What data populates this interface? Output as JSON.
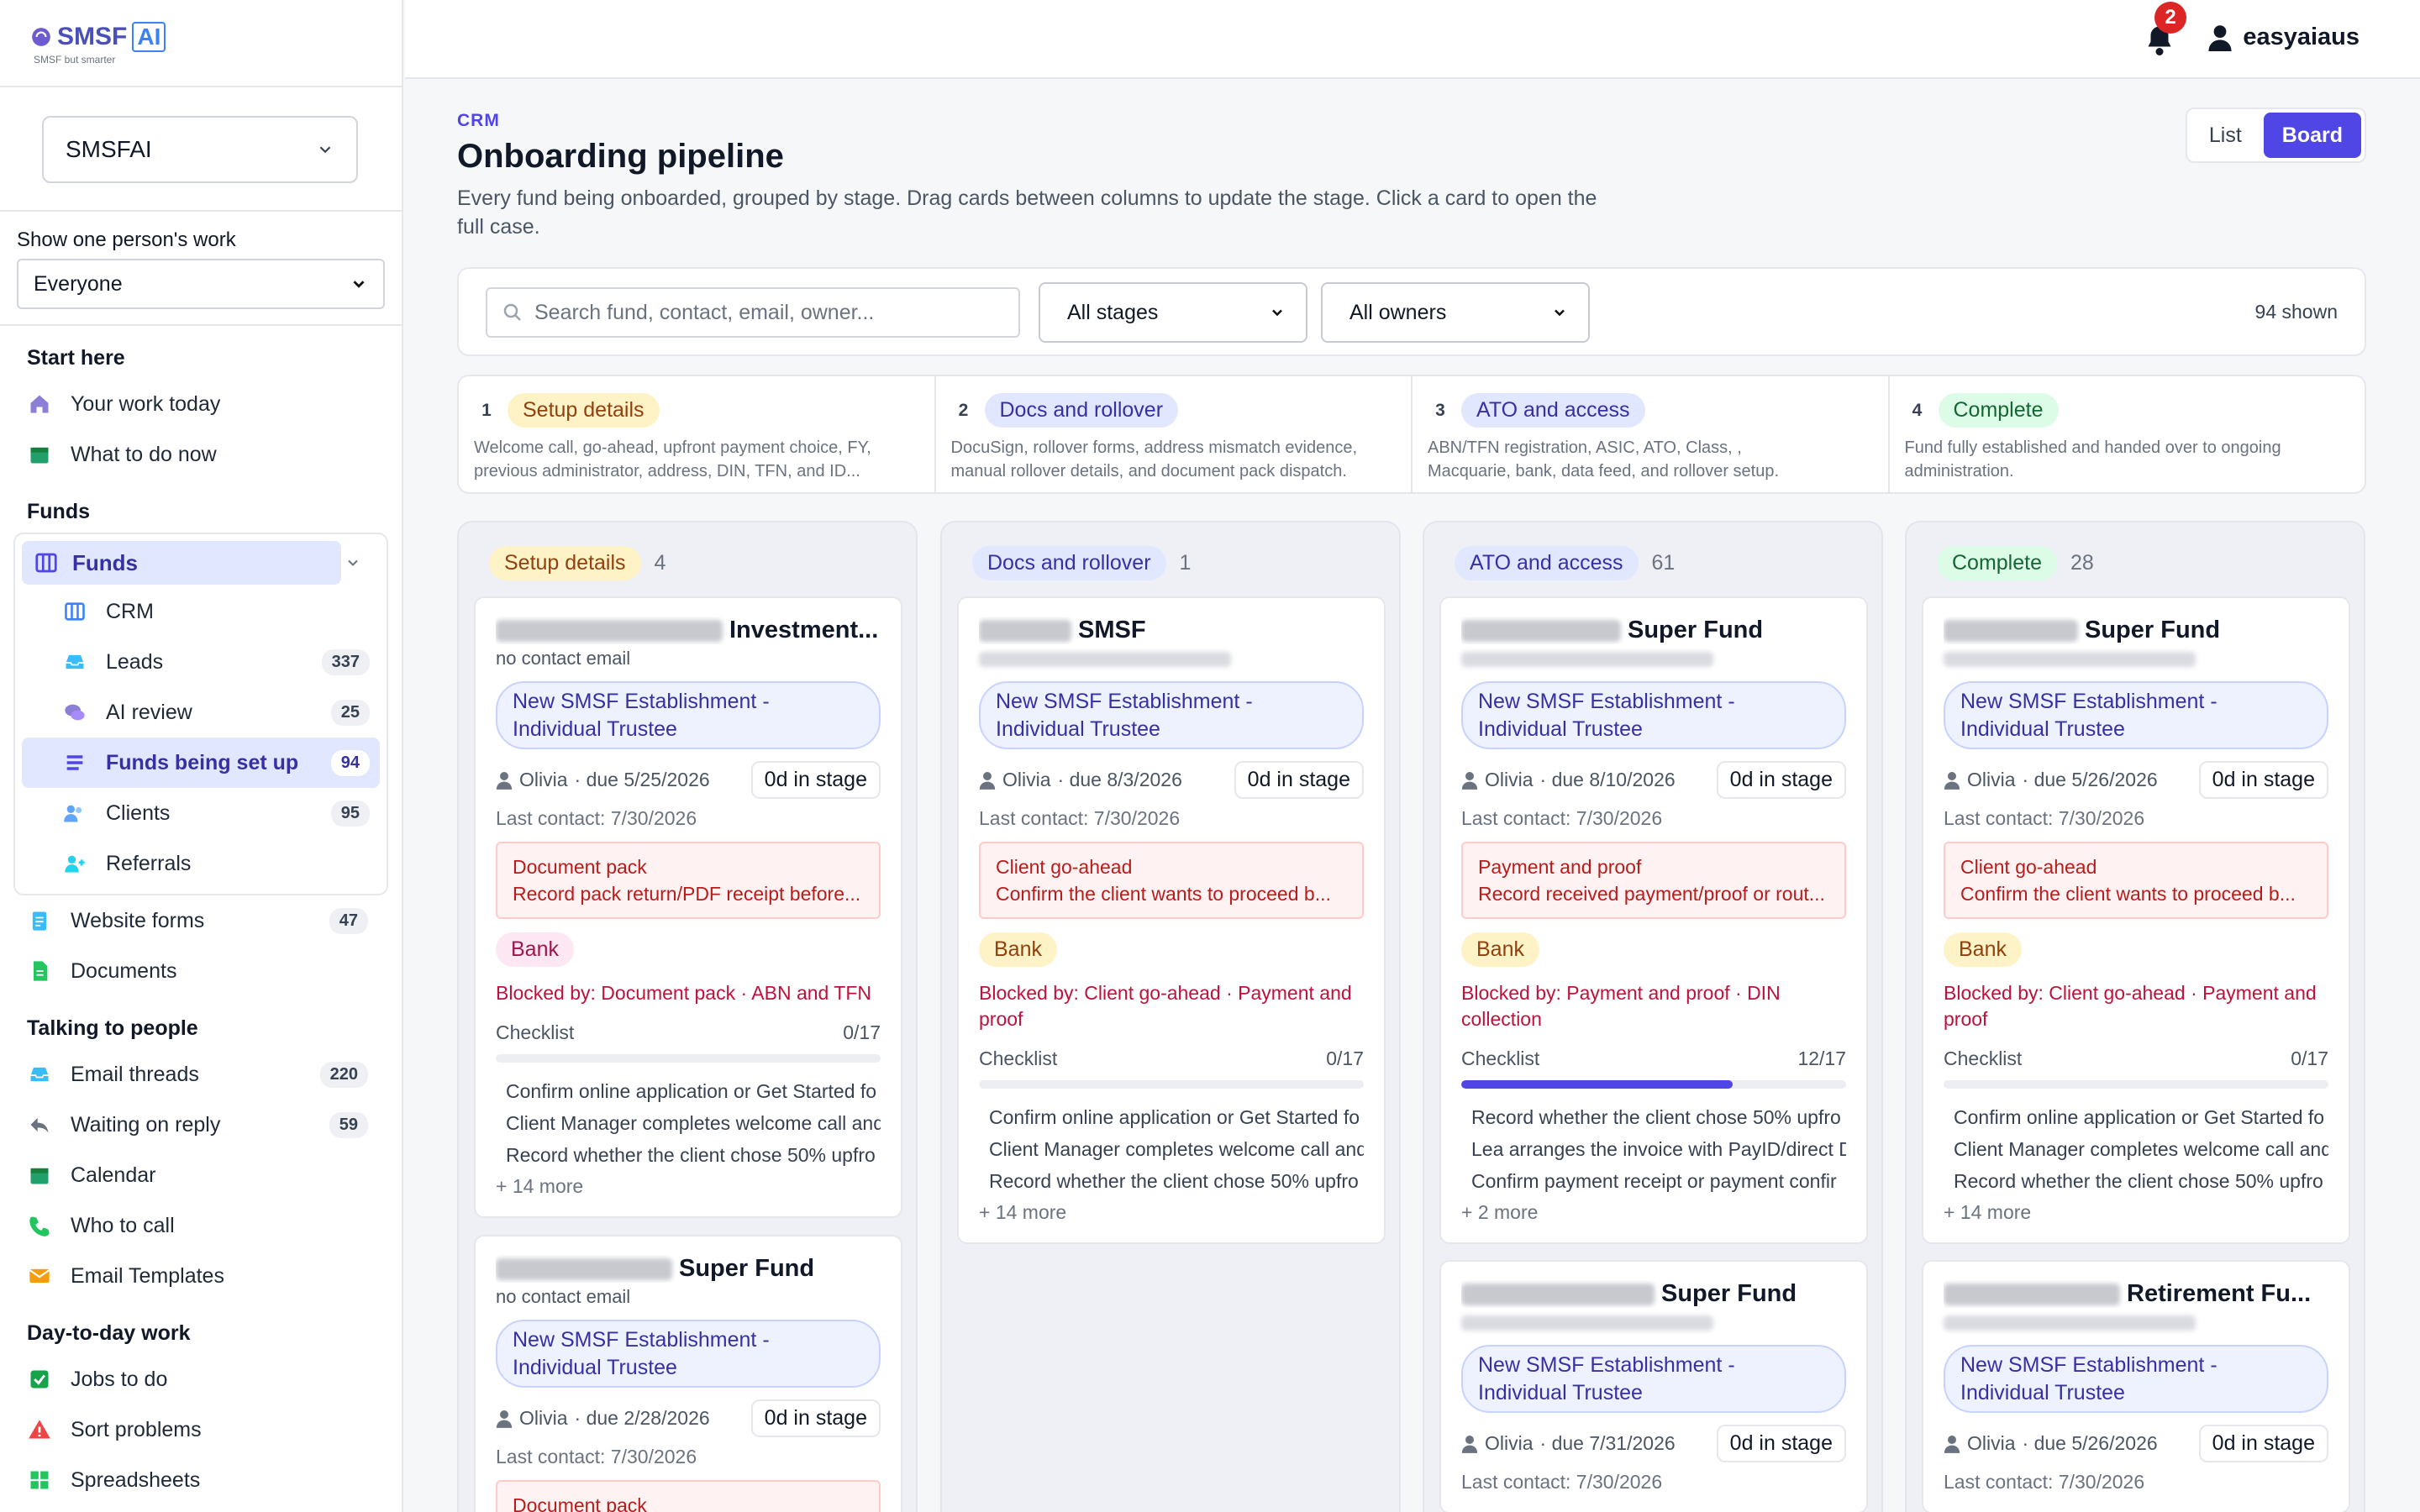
{
  "brand": {
    "name": "SMSF",
    "ai": "AI",
    "tagline": "SMSF but smarter"
  },
  "workspace": {
    "selected": "SMSFAI"
  },
  "person_filter": {
    "label": "Show one person's work",
    "selected": "Everyone"
  },
  "nav": {
    "start_title": "Start here",
    "start": [
      {
        "label": "Your work today",
        "icon": "home-icon"
      },
      {
        "label": "What to do now",
        "icon": "calendar-icon"
      }
    ],
    "funds_title": "Funds",
    "funds_label": "Funds",
    "funds_sub": [
      {
        "label": "CRM",
        "icon": "columns-icon",
        "badge": ""
      },
      {
        "label": "Leads",
        "icon": "inbox-icon",
        "badge": "337"
      },
      {
        "label": "AI review",
        "icon": "chat-icon",
        "badge": "25"
      },
      {
        "label": "Funds being set up",
        "icon": "list-icon",
        "badge": "94"
      },
      {
        "label": "Clients",
        "icon": "users-icon",
        "badge": "95"
      },
      {
        "label": "Referrals",
        "icon": "user-plus-icon",
        "badge": ""
      }
    ],
    "funds_extra": [
      {
        "label": "Website forms",
        "icon": "clipboard-icon",
        "badge": "47"
      },
      {
        "label": "Documents",
        "icon": "document-icon",
        "badge": ""
      }
    ],
    "talk_title": "Talking to people",
    "talk": [
      {
        "label": "Email threads",
        "icon": "inbox-icon",
        "badge": "220"
      },
      {
        "label": "Waiting on reply",
        "icon": "reply-icon",
        "badge": "59"
      },
      {
        "label": "Calendar",
        "icon": "calendar-icon",
        "badge": ""
      },
      {
        "label": "Who to call",
        "icon": "phone-icon",
        "badge": ""
      },
      {
        "label": "Email Templates",
        "icon": "mail-icon",
        "badge": ""
      }
    ],
    "day_title": "Day-to-day work",
    "day": [
      {
        "label": "Jobs to do",
        "icon": "check-square-icon"
      },
      {
        "label": "Sort problems",
        "icon": "warning-icon"
      },
      {
        "label": "Spreadsheets",
        "icon": "grid-icon"
      }
    ]
  },
  "topbar": {
    "notifications": "2",
    "user": "easyaiaus"
  },
  "page": {
    "crumb": "CRM",
    "title": "Onboarding pipeline",
    "desc": "Every fund being onboarded, grouped by stage. Drag cards between columns to update the stage. Click a card to open the full case.",
    "view_list": "List",
    "view_board": "Board"
  },
  "filters": {
    "search_placeholder": "Search fund, contact, email, owner...",
    "stage": "All stages",
    "owner": "All owners",
    "shown": "94 shown"
  },
  "stages": [
    {
      "num": "1",
      "name": "Setup details",
      "desc1": "Welcome call, go-ahead, upfront payment choice, FY,",
      "desc2": "previous administrator, address, DIN, TFN, and ID..."
    },
    {
      "num": "2",
      "name": "Docs and rollover",
      "desc1": "DocuSign, rollover forms, address mismatch evidence,",
      "desc2": "manual rollover details, and document pack dispatch."
    },
    {
      "num": "3",
      "name": "ATO and access",
      "desc1": "ABN/TFN registration, ASIC, ATO, Class,          ,",
      "desc2": "Macquarie, bank, data feed, and rollover setup."
    },
    {
      "num": "4",
      "name": "Complete",
      "desc1": "Fund fully established and handed over to ongoing",
      "desc2": "administration."
    }
  ],
  "columns": [
    {
      "name": "Setup details",
      "count": "4",
      "cards": [
        {
          "title": "Investment...",
          "contact": "no contact email",
          "service": "New SMSF Establishment - Individual Trustee",
          "owner": "Olivia",
          "due": "· due 5/25/2026",
          "in_stage": "0d in stage",
          "last": "Last contact: 7/30/2026",
          "alert_title": "Document pack",
          "alert_body": "Record pack return/PDF receipt before...",
          "tag": "Bank",
          "blocked": "Blocked by: Document pack · ABN and TFN",
          "checklist": "Checklist",
          "progress": "0/17",
          "pct": 0,
          "items": [
            "Confirm online application or Get Started fo",
            "Client Manager completes welcome call and",
            "Record whether the client chose 50% upfro"
          ],
          "more": "+ 14 more"
        },
        {
          "title": "Super Fund",
          "contact": "no contact email",
          "service": "New SMSF Establishment - Individual Trustee",
          "owner": "Olivia",
          "due": "· due 2/28/2026",
          "in_stage": "0d in stage",
          "last": "Last contact: 7/30/2026",
          "alert_title": "Document pack"
        }
      ]
    },
    {
      "name": "Docs and rollover",
      "count": "1",
      "cards": [
        {
          "title": "SMSF",
          "contact": "",
          "service": "New SMSF Establishment - Individual Trustee",
          "owner": "Olivia",
          "due": "· due 8/3/2026",
          "in_stage": "0d in stage",
          "last": "Last contact: 7/30/2026",
          "alert_title": "Client go-ahead",
          "alert_body": "Confirm the client wants to proceed b...",
          "tag": "Bank",
          "blocked": "Blocked by: Client go-ahead · Payment and proof",
          "checklist": "Checklist",
          "progress": "0/17",
          "pct": 0,
          "items": [
            "Confirm online application or Get Started fo",
            "Client Manager completes welcome call and",
            "Record whether the client chose 50% upfro"
          ],
          "more": "+ 14 more"
        }
      ]
    },
    {
      "name": "ATO and access",
      "count": "61",
      "cards": [
        {
          "title": "Super Fund",
          "contact": "",
          "service": "New SMSF Establishment - Individual Trustee",
          "owner": "Olivia",
          "due": "· due 8/10/2026",
          "in_stage": "0d in stage",
          "last": "Last contact: 7/30/2026",
          "alert_title": "Payment and proof",
          "alert_body": "Record received payment/proof or rout...",
          "tag": "Bank",
          "blocked": "Blocked by: Payment and proof · DIN collection",
          "checklist": "Checklist",
          "progress": "12/17",
          "pct": 70.6,
          "items": [
            "Record whether the client chose 50% upfro",
            "Lea arranges the invoice with PayID/direct D",
            "Confirm payment receipt or payment confir"
          ],
          "more": "+ 2 more"
        },
        {
          "title": "Super Fund",
          "contact": "",
          "service": "New SMSF Establishment - Individual Trustee",
          "owner": "Olivia",
          "due": "· due 7/31/2026",
          "in_stage": "0d in stage",
          "last": "Last contact: 7/30/2026"
        }
      ]
    },
    {
      "name": "Complete",
      "count": "28",
      "cards": [
        {
          "title": "Super Fund",
          "contact": "",
          "service": "New SMSF Establishment - Individual Trustee",
          "owner": "Olivia",
          "due": "· due 5/26/2026",
          "in_stage": "0d in stage",
          "last": "Last contact: 7/30/2026",
          "alert_title": "Client go-ahead",
          "alert_body": "Confirm the client wants to proceed b...",
          "tag": "Bank",
          "blocked": "Blocked by: Client go-ahead · Payment and proof",
          "checklist": "Checklist",
          "progress": "0/17",
          "pct": 0,
          "items": [
            "Confirm online application or Get Started fo",
            "Client Manager completes welcome call and",
            "Record whether the client chose 50% upfro"
          ],
          "more": "+ 14 more"
        },
        {
          "title": "Retirement Fu...",
          "contact": "",
          "service": "New SMSF Establishment - Individual Trustee",
          "owner": "Olivia",
          "due": "· due 5/26/2026",
          "in_stage": "0d in stage",
          "last": "Last contact: 7/30/2026"
        }
      ]
    }
  ],
  "colors": {
    "accent": "#4f46e5",
    "amber": "#92400e",
    "danger": "#be123c"
  }
}
